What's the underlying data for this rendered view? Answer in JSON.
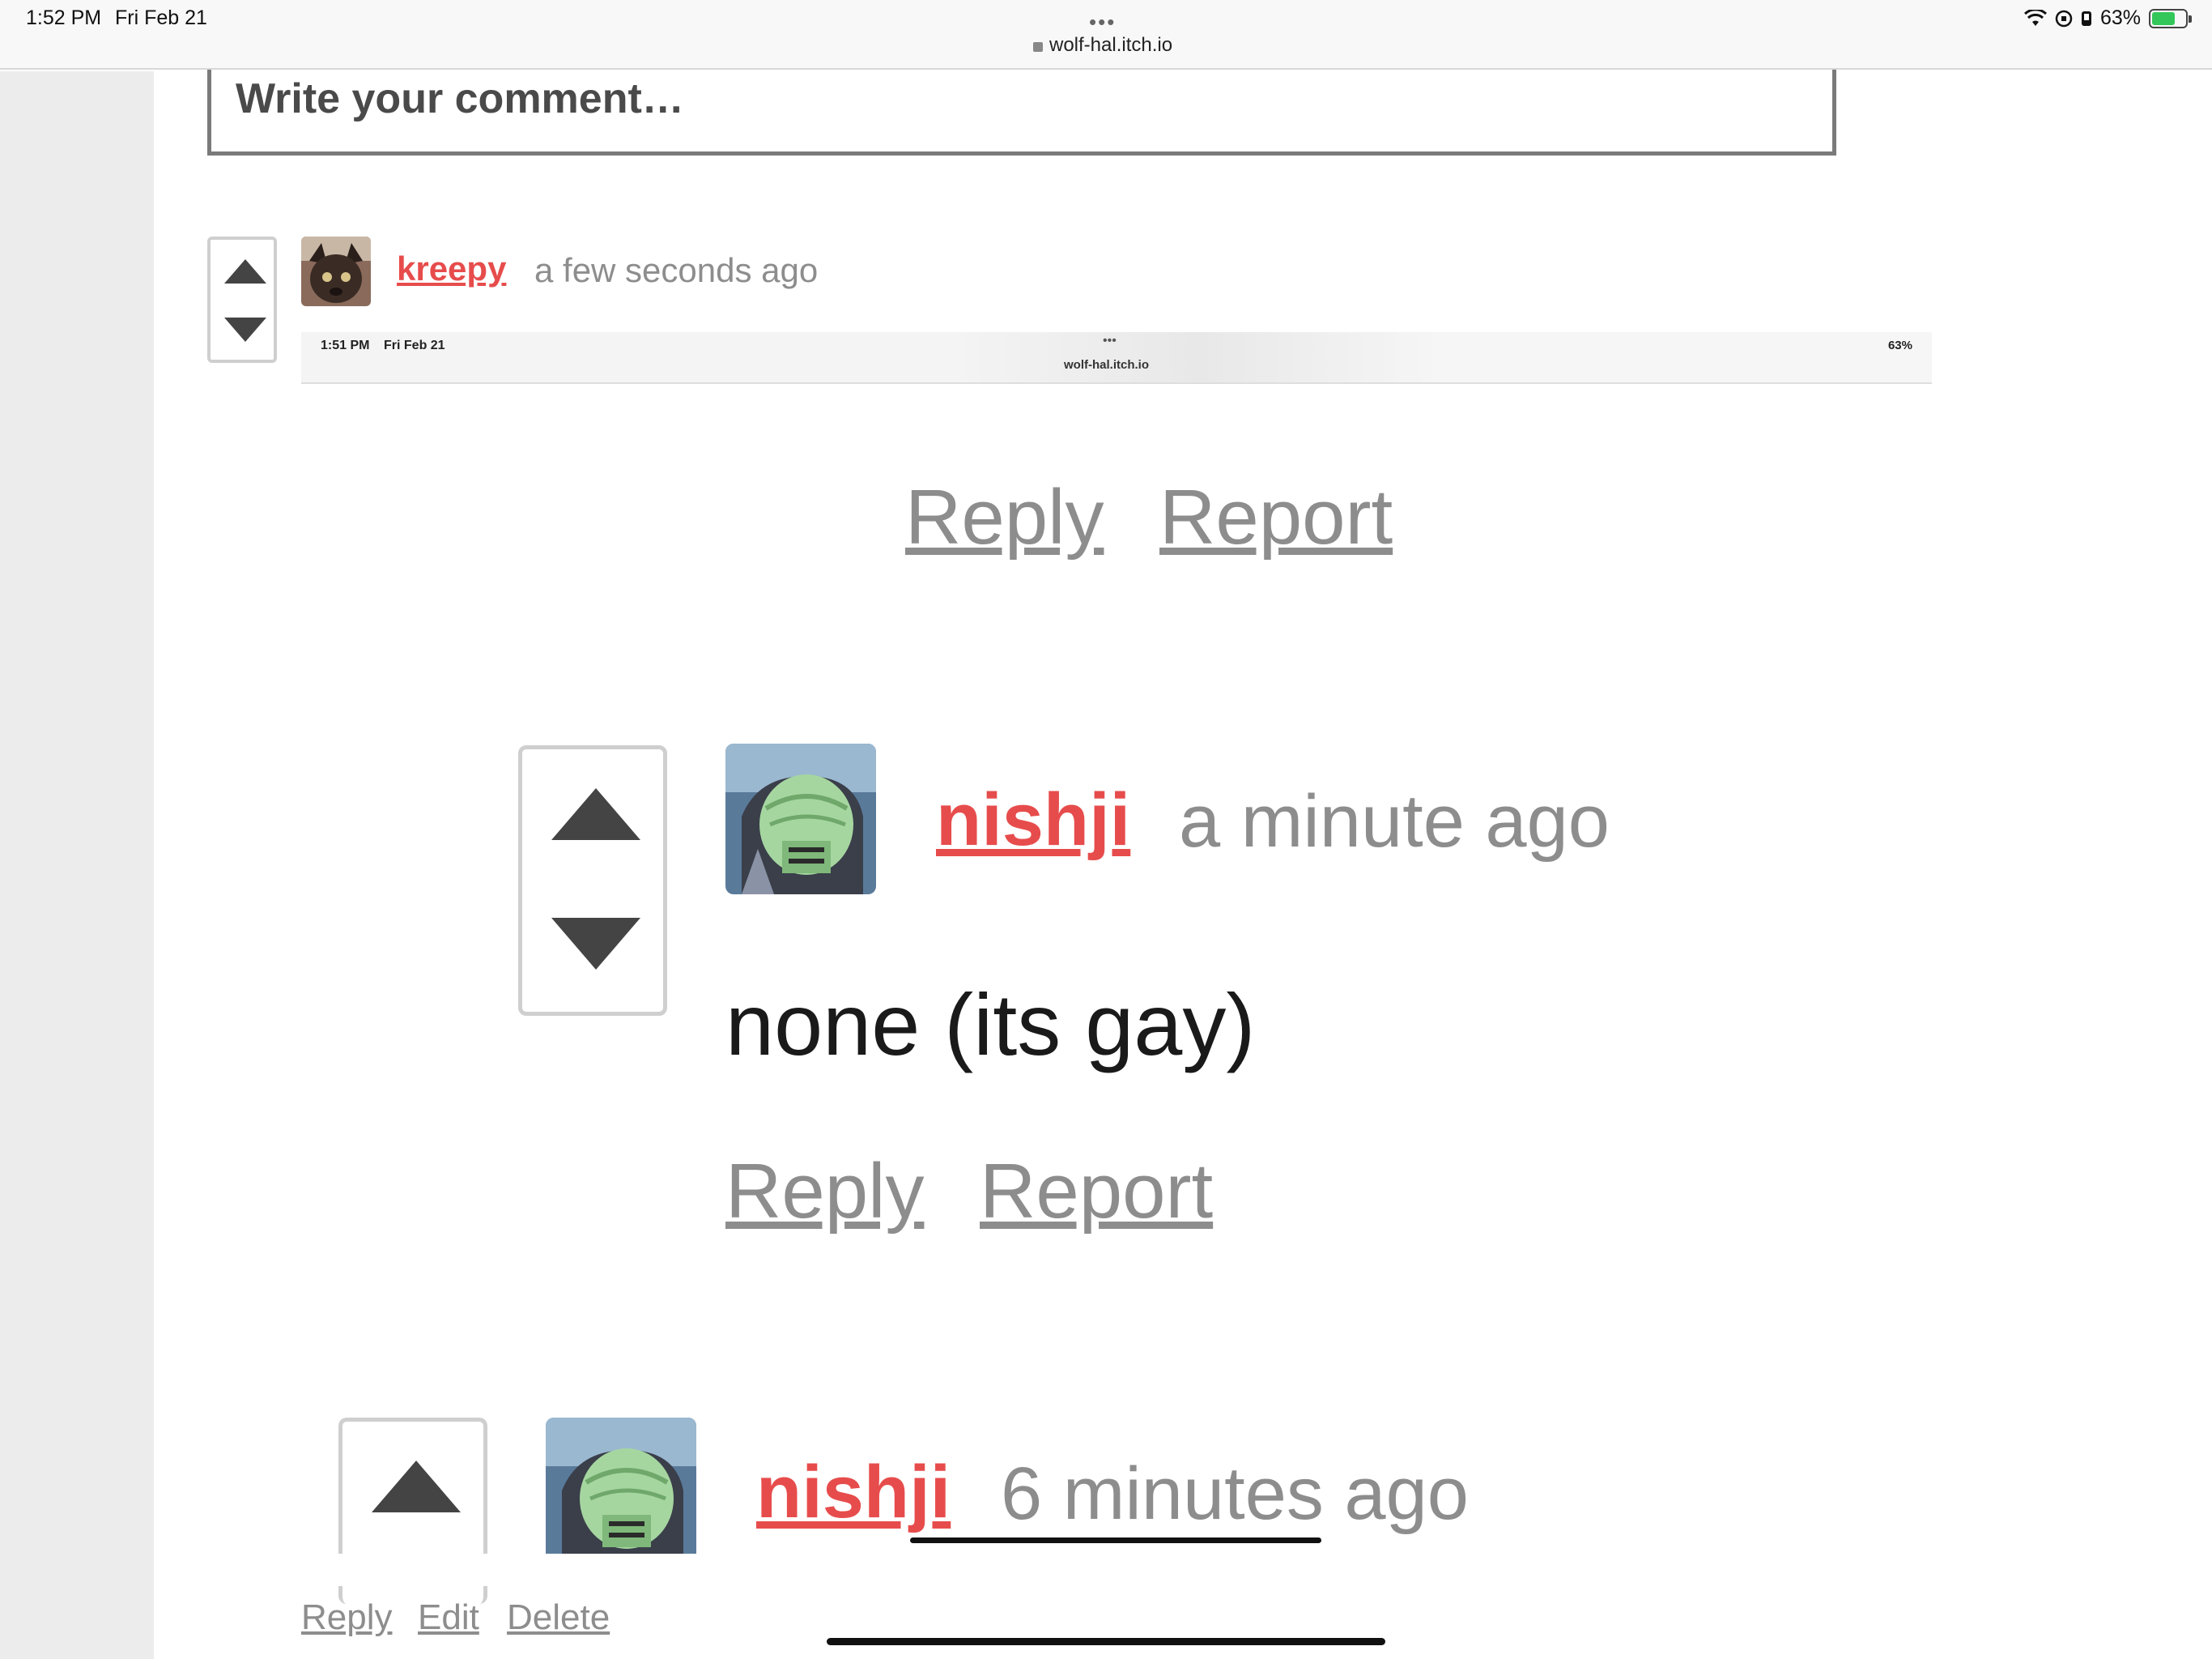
{
  "status_bar": {
    "time": "1:52 PM",
    "date": "Fri Feb 21",
    "dots": "•••",
    "url": "wolf-hal.itch.io",
    "battery": "63%"
  },
  "comment_input": {
    "placeholder": "Write your comment…"
  },
  "comments": [
    {
      "username": "kreepy",
      "time": "a few seconds ago",
      "embedded_screenshot": {
        "time": "1:51 PM",
        "date": "Fri Feb 21",
        "dots": "•••",
        "url": "wolf-hal.itch.io",
        "battery": "63%"
      },
      "reply_label": "Reply",
      "report_label": "Report"
    },
    {
      "username": "nishji",
      "time": "a minute ago",
      "body": "none (its gay)",
      "reply_label": "Reply",
      "report_label": "Report"
    },
    {
      "username": "nishji",
      "time": "6 minutes ago"
    }
  ],
  "footer_actions": {
    "reply_label": "Reply",
    "edit_label": "Edit",
    "delete_label": "Delete"
  }
}
